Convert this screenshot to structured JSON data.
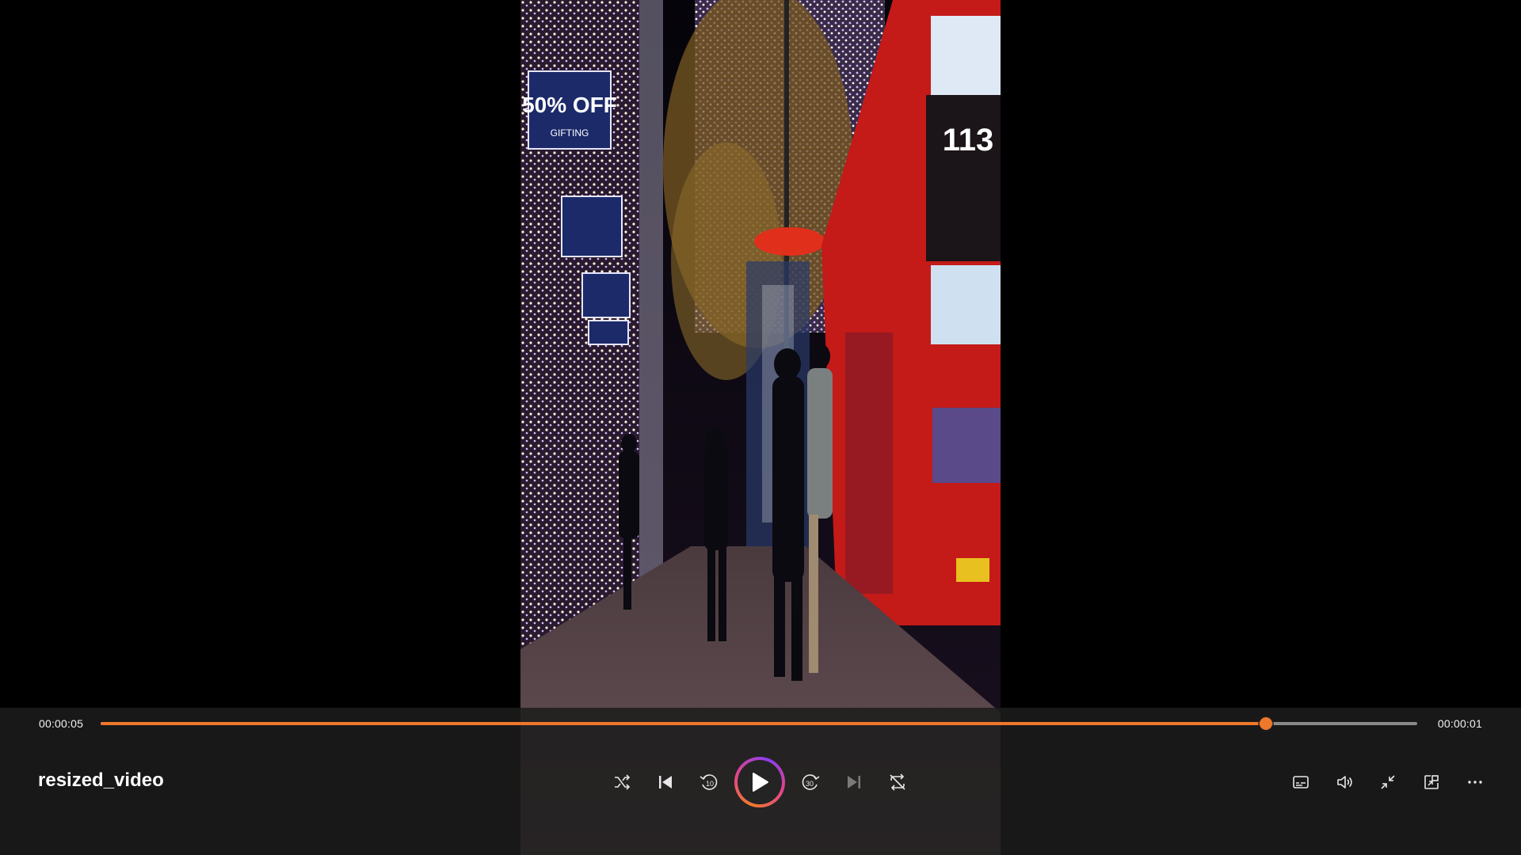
{
  "player": {
    "title": "resized_video",
    "elapsed": "00:00:05",
    "remaining": "00:00:01",
    "progress_fraction": 0.885,
    "accent_color": "#f0782a"
  },
  "video": {
    "bus_route_number": "113",
    "shop_sign_text": "50% OFF",
    "shop_sign_subtext": "GIFTING"
  },
  "controls": {
    "center": [
      {
        "name": "shuffle-button",
        "icon": "shuffle-icon"
      },
      {
        "name": "previous-button",
        "icon": "skip-previous-icon"
      },
      {
        "name": "rewind-10-button",
        "icon": "rewind-10-icon"
      },
      {
        "name": "play-button",
        "icon": "play-icon"
      },
      {
        "name": "forward-30-button",
        "icon": "forward-30-icon"
      },
      {
        "name": "next-button",
        "icon": "skip-next-icon"
      },
      {
        "name": "repeat-button",
        "icon": "repeat-off-icon"
      }
    ],
    "right": [
      {
        "name": "captions-button",
        "icon": "captions-icon"
      },
      {
        "name": "volume-button",
        "icon": "volume-icon"
      },
      {
        "name": "exit-fullscreen-button",
        "icon": "exit-fullscreen-icon"
      },
      {
        "name": "mini-player-button",
        "icon": "mini-player-icon"
      },
      {
        "name": "more-options-button",
        "icon": "more-icon"
      }
    ]
  }
}
